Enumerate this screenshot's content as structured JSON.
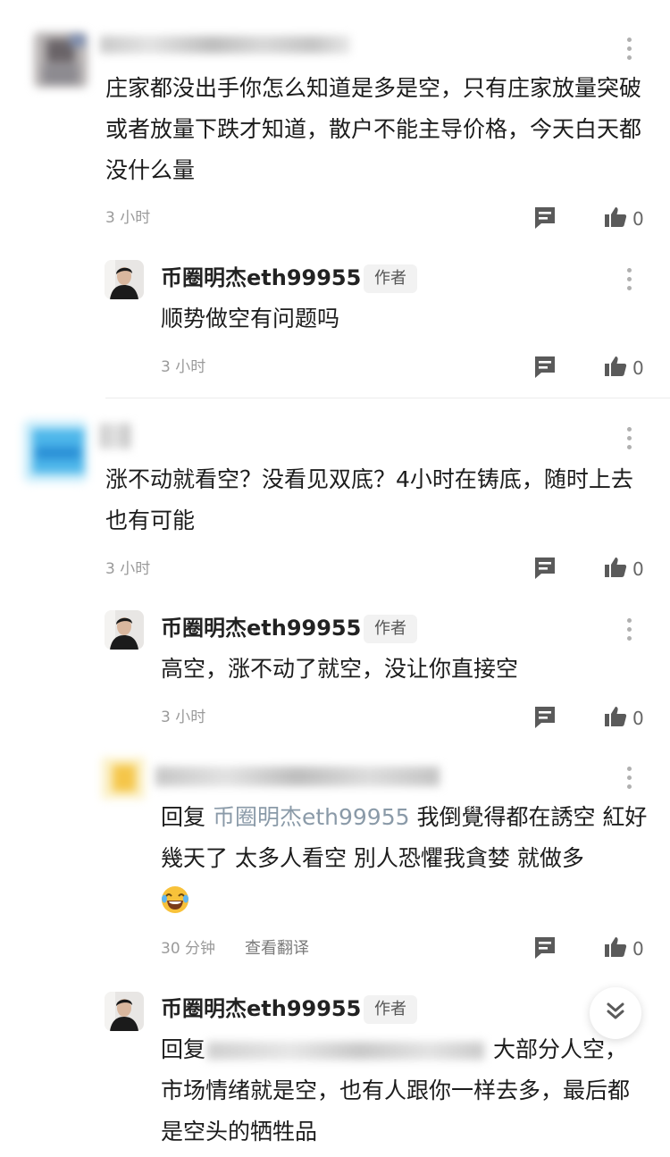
{
  "comments": [
    {
      "text": "庄家都没出手你怎么知道是多是空，只有庄家放量突破或者放量下跌才知道，散户不能主导价格，今天白天都没什么量",
      "time": "3 小时",
      "likes": "0"
    },
    {
      "author": "币圈明杰eth99955",
      "badge": "作者",
      "text": "顺势做空有问题吗",
      "time": "3 小时",
      "likes": "0"
    },
    {
      "text": "涨不动就看空？没看见双底？4小时在铸底，随时上去也有可能",
      "time": "3 小时",
      "likes": "0"
    },
    {
      "author": "币圈明杰eth99955",
      "badge": "作者",
      "text": "高空，涨不动了就空，没让你直接空",
      "time": "3 小时",
      "likes": "0"
    },
    {
      "reply_prefix": "回复",
      "mention": "币圈明杰eth99955",
      "text": "我倒覺得都在誘空 紅好幾天了 太多人看空 別人恐懼我貪婪 就做多",
      "emoji": "😂",
      "time": "30 分钟",
      "translate": "查看翻译",
      "likes": "0"
    },
    {
      "author": "币圈明杰eth99955",
      "badge": "作者",
      "reply_prefix": "回复",
      "text_after_mention": "大部分人空，",
      "text": "市场情绪就是空，也有人跟你一样去多，最后都是空头的牺牲品"
    }
  ],
  "colors": {
    "text": "#1c1c1c",
    "meta": "#9a9a9a",
    "icon": "#5a5a5a",
    "mention": "#8a9aa8"
  },
  "icons": [
    "more-vertical-icon",
    "reply-comment-icon",
    "thumbs-up-icon",
    "double-chevron-down-icon"
  ]
}
